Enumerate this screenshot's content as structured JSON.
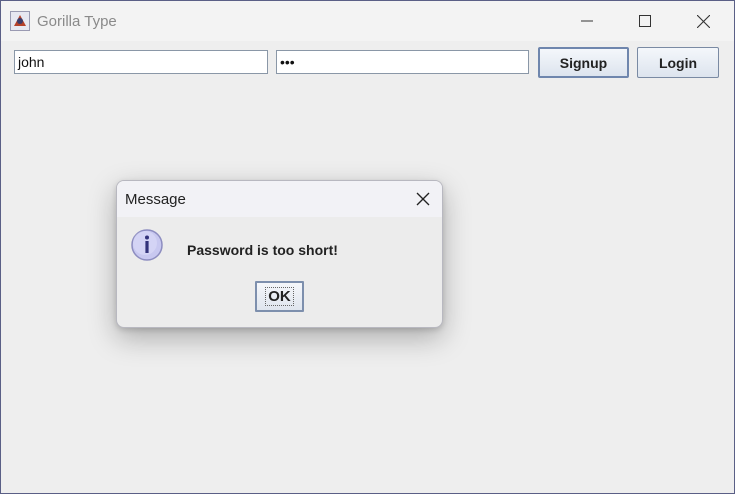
{
  "window": {
    "title": "Gorilla Type",
    "icon": "java-app-icon",
    "controls": [
      "minimize-icon",
      "maximize-icon",
      "close-icon"
    ]
  },
  "form": {
    "username_value": "john",
    "password_value": "•••",
    "signup_label": "Signup",
    "login_label": "Login"
  },
  "dialog": {
    "title": "Message",
    "icon": "info-icon",
    "message": "Password is too short!",
    "ok_label": "OK"
  },
  "colors": {
    "window_bg": "#eeeeee",
    "accent_border": "#6f86ad",
    "info_icon_fill": "#c8c8f0"
  }
}
